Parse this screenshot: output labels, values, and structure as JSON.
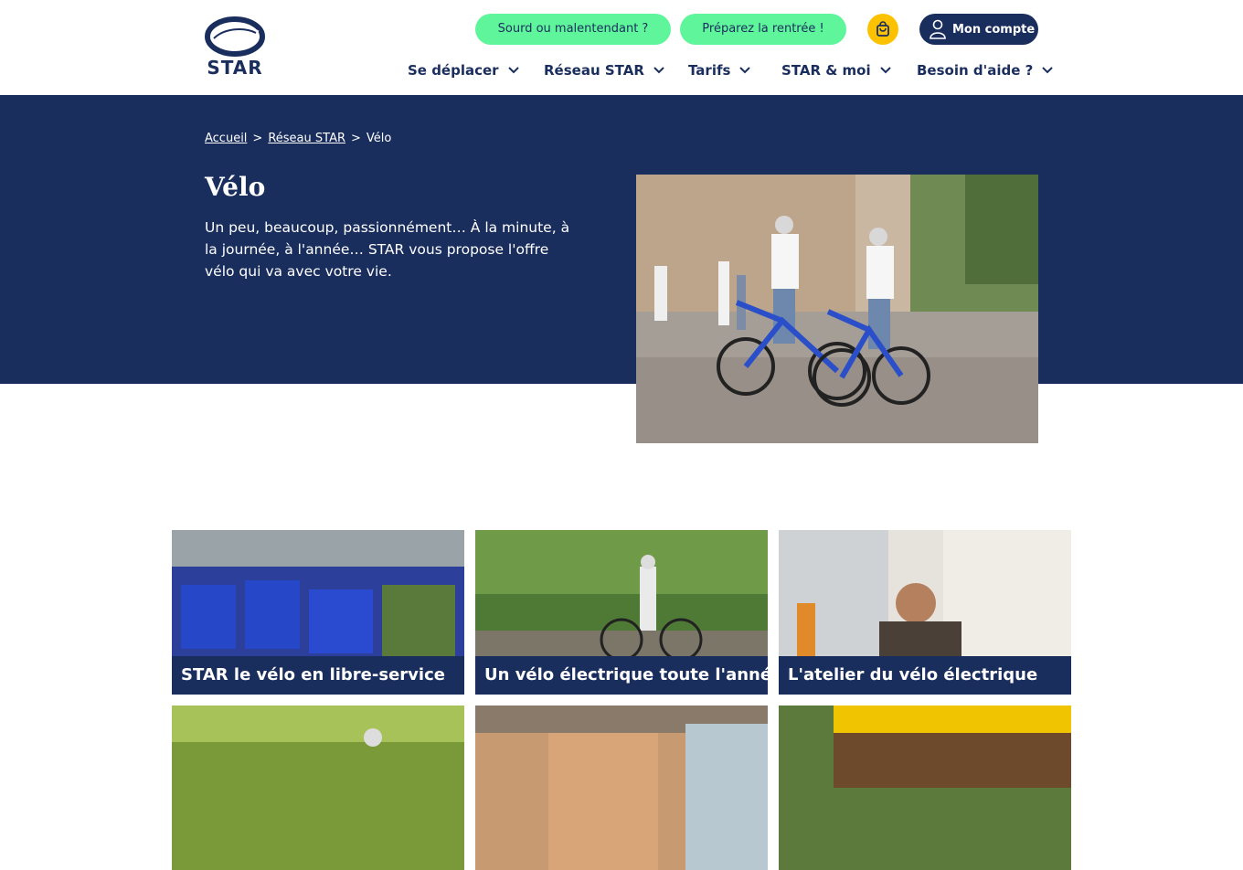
{
  "header": {
    "logo_text": "STAR",
    "sourd_label": "Sourd ou malentendant ?",
    "rentree_label": "Préparez la rentrée !",
    "account_label": "Mon compte",
    "nav": [
      {
        "label": "Se déplacer"
      },
      {
        "label": "Réseau STAR"
      },
      {
        "label": "Tarifs"
      },
      {
        "label": "STAR & moi"
      },
      {
        "label": "Besoin d'aide ?"
      }
    ]
  },
  "breadcrumb": {
    "home": "Accueil",
    "sep1": ">",
    "reseau": "Réseau STAR",
    "sep2": ">",
    "current": "Vélo"
  },
  "hero": {
    "title": "Vélo",
    "intro": "Un peu, beaucoup, passionnément… À la minute, à la journée, à l'année… STAR vous propose l'offre vélo qui va avec votre vie."
  },
  "cards": [
    {
      "caption": "STAR le vélo en libre-service"
    },
    {
      "caption": "Un vélo électrique toute l'année"
    },
    {
      "caption": "L'atelier du vélo électrique"
    }
  ],
  "colors": {
    "navy": "#1a2e5e",
    "green": "#5ff59a",
    "yellow": "#fcc200",
    "white": "#ffffff"
  }
}
